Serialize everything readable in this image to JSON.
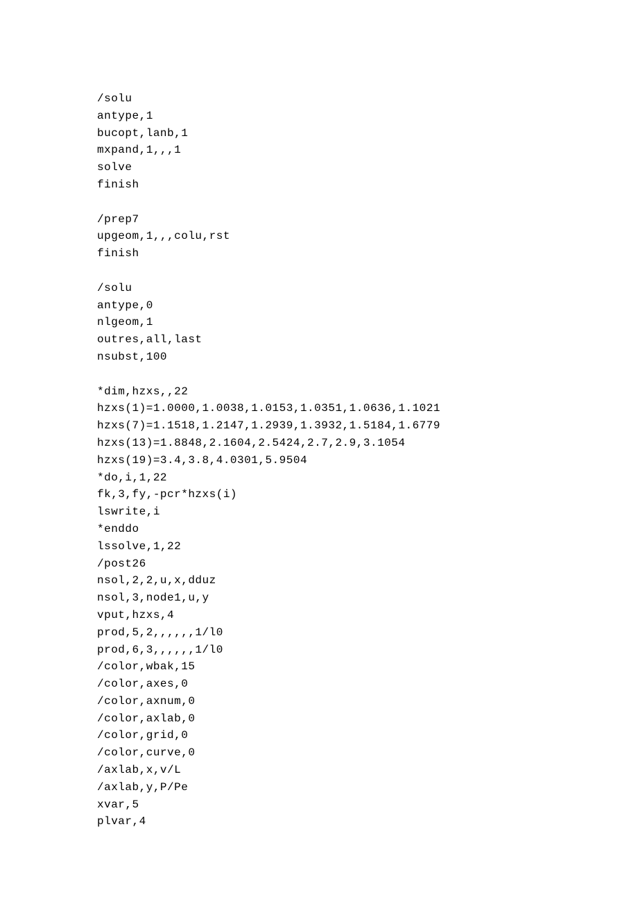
{
  "lines": [
    "/solu",
    "antype,1",
    "bucopt,lanb,1",
    "mxpand,1,,,1",
    "solve",
    "finish",
    "",
    "/prep7",
    "upgeom,1,,,colu,rst",
    "finish",
    "",
    "/solu",
    "antype,0",
    "nlgeom,1",
    "outres,all,last",
    "nsubst,100",
    "",
    "*dim,hzxs,,22",
    "hzxs(1)=1.0000,1.0038,1.0153,1.0351,1.0636,1.1021",
    "hzxs(7)=1.1518,1.2147,1.2939,1.3932,1.5184,1.6779",
    "hzxs(13)=1.8848,2.1604,2.5424,2.7,2.9,3.1054",
    "hzxs(19)=3.4,3.8,4.0301,5.9504",
    "*do,i,1,22",
    "fk,3,fy,-pcr*hzxs(i)",
    "lswrite,i",
    "*enddo",
    "lssolve,1,22",
    "/post26",
    "nsol,2,2,u,x,dduz",
    "nsol,3,node1,u,y",
    "vput,hzxs,4",
    "prod,5,2,,,,,,1/l0",
    "prod,6,3,,,,,,1/l0",
    "/color,wbak,15",
    "/color,axes,0",
    "/color,axnum,0",
    "/color,axlab,0",
    "/color,grid,0",
    "/color,curve,0",
    "/axlab,x,v/L",
    "/axlab,y,P/Pe",
    "xvar,5",
    "plvar,4"
  ]
}
